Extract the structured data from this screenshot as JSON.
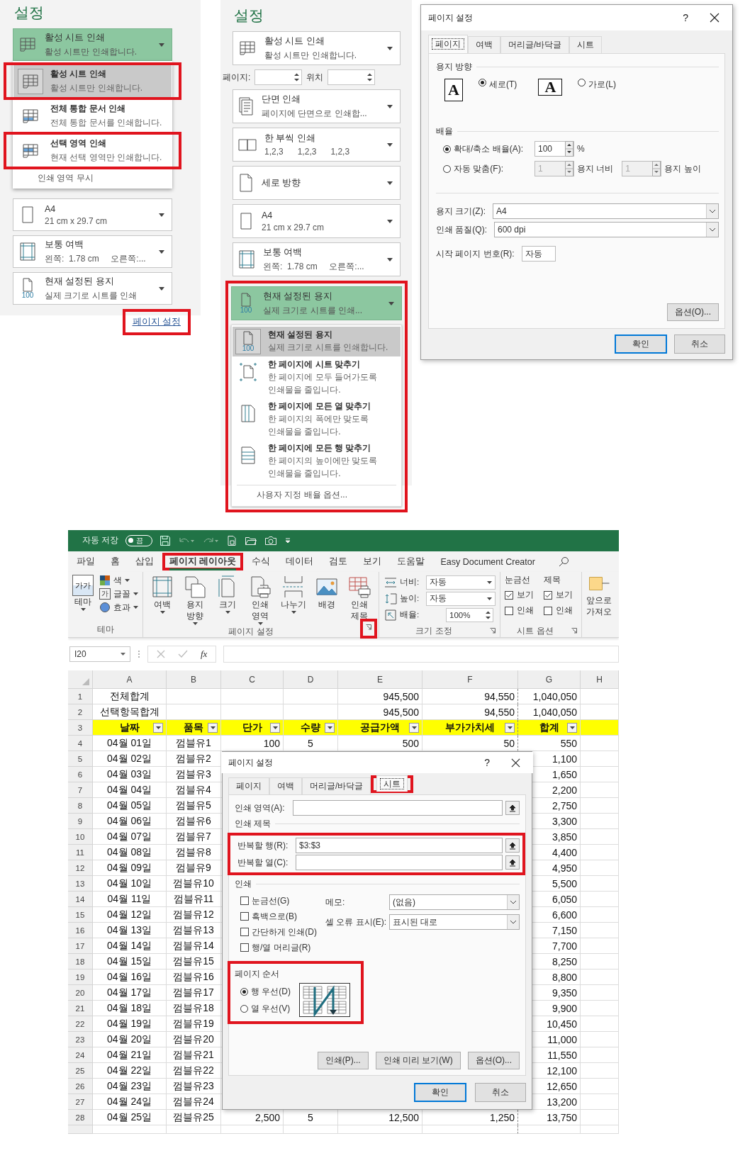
{
  "panel1": {
    "heading": "설정",
    "print_what": {
      "title": "활성 시트 인쇄",
      "subtitle": "활성 시트만 인쇄합니다.",
      "expanded": true
    },
    "menu": [
      {
        "title": "활성 시트 인쇄",
        "subtitle": "활성 시트만 인쇄합니다.",
        "selected": true,
        "highlighted": true
      },
      {
        "title": "전체 통합 문서 인쇄",
        "subtitle": "전체 통합 문서를 인쇄합니다.",
        "selected": false,
        "highlighted": false
      },
      {
        "title": "선택 영역 인쇄",
        "subtitle": "현재 선택 영역만 인쇄합니다.",
        "selected": false,
        "highlighted": true
      }
    ],
    "ignore_print_area": "인쇄 영역 무시",
    "settings": [
      {
        "title": "A4",
        "subtitle": "21 cm x 29.7 cm"
      },
      {
        "title": "보통 여백",
        "subtitle": "왼쪽:  1.78 cm     오른쪽:..."
      },
      {
        "badge": "100",
        "title": "현재 설정된 용지",
        "subtitle": "실제 크기로 시트를 인쇄"
      }
    ],
    "page_setup_link": {
      "label": "페이지 설정",
      "highlighted": true
    }
  },
  "panel2": {
    "heading": "설정",
    "settings": [
      {
        "kind": "dropdown",
        "title": "활성 시트 인쇄",
        "subtitle": "활성 시트만 인쇄합니다."
      },
      {
        "kind": "pages",
        "pages_label": "페이지:",
        "to_label": "위치"
      },
      {
        "kind": "dropdown",
        "title": "단면 인쇄",
        "subtitle": "페이지에 단면으로 인쇄합..."
      },
      {
        "kind": "dropdown",
        "title": "한 부씩 인쇄",
        "subtitle": "1,2,3      1,2,3      1,2,3"
      },
      {
        "kind": "dropdown",
        "title": "세로 방향"
      },
      {
        "kind": "dropdown",
        "title": "A4",
        "subtitle": "21 cm x 29.7 cm"
      },
      {
        "kind": "dropdown",
        "title": "보통 여백",
        "subtitle": "왼쪽:  1.78 cm     오른쪽:..."
      }
    ],
    "scaling": {
      "highlighted": true,
      "expanded": true,
      "badge": "100",
      "title": "현재 설정된 용지",
      "subtitle": "실제 크기로 시트를 인쇄...",
      "menu": [
        {
          "badge": "100",
          "title": "현재 설정된 용지",
          "lines": [
            "실제 크기로 시트를 인쇄합니다."
          ],
          "selected": true
        },
        {
          "title": "한 페이지에 시트 맞추기",
          "lines": [
            "한 페이지에 모두 들어가도록",
            "인쇄물을 줄입니다."
          ],
          "selected": false
        },
        {
          "title": "한 페이지에 모든 열 맞추기",
          "lines": [
            "한 페이지의 폭에만 맞도록",
            "인쇄물을 줄입니다."
          ],
          "selected": false
        },
        {
          "title": "한 페이지에 모든 행 맞추기",
          "lines": [
            "한 페이지의 높이에만 맞도록",
            "인쇄물을 줄입니다."
          ],
          "selected": false
        }
      ],
      "custom": "사용자 지정 배율 옵션..."
    }
  },
  "dialog1": {
    "title": "페이지 설정",
    "help": "?",
    "tabs": [
      {
        "label": "페이지",
        "selected": true
      },
      {
        "label": "여백",
        "selected": false
      },
      {
        "label": "머리글/바닥글",
        "selected": false
      },
      {
        "label": "시트",
        "selected": false
      }
    ],
    "orientation": {
      "heading": "용지 방향",
      "options": [
        {
          "letter": "A",
          "label": "세로(T)",
          "selected": true
        },
        {
          "letter": "A",
          "label": "가로(L)",
          "selected": false
        }
      ]
    },
    "scaling": {
      "heading": "배율",
      "options": [
        {
          "kind": "percent",
          "label": "확대/축소 배율(A):",
          "value": "100",
          "unit": "%",
          "selected": true
        },
        {
          "kind": "fit",
          "label": "자동 맞춤(F):",
          "wide": "1",
          "wide_label": "용지 너비",
          "tall": "1",
          "tall_label": "용지 높이",
          "selected": false
        }
      ]
    },
    "fields": [
      {
        "kind": "select",
        "label": "용지 크기(Z):",
        "value": "A4"
      },
      {
        "kind": "select",
        "label": "인쇄 품질(Q):",
        "value": "600 dpi"
      },
      {
        "kind": "text",
        "label": "시작 페이지 번호(R):",
        "value": "자동"
      }
    ],
    "options_button": "옵션(O)...",
    "footer": [
      {
        "label": "확인",
        "default": true
      },
      {
        "label": "취소",
        "default": false
      }
    ]
  },
  "excel": {
    "quick_access": {
      "autosave_label": "자동 저장",
      "autosave_state": "끔",
      "autosave_on": false
    },
    "tabs": [
      {
        "label": "파일",
        "selected": false,
        "highlighted": false
      },
      {
        "label": "홈",
        "selected": false,
        "highlighted": false
      },
      {
        "label": "삽입",
        "selected": false,
        "highlighted": false
      },
      {
        "label": "페이지 레이아웃",
        "selected": true,
        "highlighted": true
      },
      {
        "label": "수식",
        "selected": false,
        "highlighted": false
      },
      {
        "label": "데이터",
        "selected": false,
        "highlighted": false
      },
      {
        "label": "검토",
        "selected": false,
        "highlighted": false
      },
      {
        "label": "보기",
        "selected": false,
        "highlighted": false
      },
      {
        "label": "도움말",
        "selected": false,
        "highlighted": false
      },
      {
        "label": "Easy Document Creator",
        "selected": false,
        "highlighted": false
      }
    ],
    "theme_group": {
      "name": "테마",
      "big": {
        "label": "테마",
        "icon_text": "가가"
      },
      "small": [
        {
          "kind": "colors",
          "label": "색"
        },
        {
          "kind": "fonts",
          "label": "글꼴",
          "icon_text": "가"
        },
        {
          "kind": "effects",
          "label": "효과"
        }
      ]
    },
    "page_setup_group": {
      "name": "페이지 설정",
      "launcher_highlighted": true,
      "buttons": [
        {
          "lines": [
            "여백"
          ],
          "menu": true
        },
        {
          "lines": [
            "용지",
            "방향"
          ],
          "menu": true
        },
        {
          "lines": [
            "크기"
          ],
          "menu": true
        },
        {
          "lines": [
            "인쇄",
            "영역"
          ],
          "menu": true
        },
        {
          "lines": [
            "나누기"
          ],
          "menu": true
        },
        {
          "lines": [
            "배경"
          ],
          "menu": false
        },
        {
          "lines": [
            "인쇄",
            "제목"
          ],
          "menu": false
        }
      ]
    },
    "scale_group": {
      "name": "크기 조정",
      "rows": [
        {
          "kind": "dropdown",
          "label": "너비:",
          "value": "자동"
        },
        {
          "kind": "dropdown",
          "label": "높이:",
          "value": "자동"
        },
        {
          "kind": "spin",
          "label": "배율:",
          "value": "100%"
        }
      ]
    },
    "sheet_options_group": {
      "name": "시트 옵션",
      "columns": [
        {
          "title": "눈금선",
          "view": {
            "label": "보기",
            "checked": true
          },
          "print": {
            "label": "인쇄",
            "checked": false
          }
        },
        {
          "title": "제목",
          "view": {
            "label": "보기",
            "checked": true
          },
          "print": {
            "label": "인쇄",
            "checked": false
          }
        }
      ]
    },
    "arrange": {
      "lines": [
        "앞으로",
        "가져오"
      ]
    },
    "name_box": "I20",
    "function_label": "fx",
    "columns": [
      "A",
      "B",
      "C",
      "D",
      "E",
      "F",
      "G",
      "H"
    ],
    "rows": [
      {
        "kind": "total",
        "n": "1",
        "a": "전체합계",
        "e": "945,500",
        "f": "94,550",
        "g": "1,040,050"
      },
      {
        "kind": "total",
        "n": "2",
        "a": "선택항목합계",
        "e": "945,500",
        "f": "94,550",
        "g": "1,040,050"
      },
      {
        "kind": "header",
        "n": "3",
        "a": "날짜",
        "b": "품목",
        "c": "단가",
        "d": "수량",
        "e": "공급가액",
        "f": "부가가치세",
        "g": "합계"
      },
      {
        "kind": "data",
        "n": "4",
        "a": "04월 01일",
        "b": "껌블유1",
        "c": "100",
        "d": "5",
        "e": "500",
        "f": "50",
        "g": "550"
      },
      {
        "kind": "data",
        "n": "5",
        "a": "04월 02일",
        "b": "껌블유2",
        "g": "1,100"
      },
      {
        "kind": "data",
        "n": "6",
        "a": "04월 03일",
        "b": "껌블유3",
        "g": "1,650"
      },
      {
        "kind": "data",
        "n": "7",
        "a": "04월 04일",
        "b": "껌블유4",
        "g": "2,200"
      },
      {
        "kind": "data",
        "n": "8",
        "a": "04월 05일",
        "b": "껌블유5",
        "g": "2,750"
      },
      {
        "kind": "data",
        "n": "9",
        "a": "04월 06일",
        "b": "껌블유6",
        "g": "3,300"
      },
      {
        "kind": "data",
        "n": "10",
        "a": "04월 07일",
        "b": "껌블유7",
        "g": "3,850"
      },
      {
        "kind": "data",
        "n": "11",
        "a": "04월 08일",
        "b": "껌블유8",
        "g": "4,400"
      },
      {
        "kind": "data",
        "n": "12",
        "a": "04월 09일",
        "b": "껌블유9",
        "g": "4,950"
      },
      {
        "kind": "data",
        "n": "13",
        "a": "04월 10일",
        "b": "껌블유10",
        "g": "5,500"
      },
      {
        "kind": "data",
        "n": "14",
        "a": "04월 11일",
        "b": "껌블유11",
        "g": "6,050"
      },
      {
        "kind": "data",
        "n": "15",
        "a": "04월 12일",
        "b": "껌블유12",
        "g": "6,600"
      },
      {
        "kind": "data",
        "n": "16",
        "a": "04월 13일",
        "b": "껌블유13",
        "g": "7,150"
      },
      {
        "kind": "data",
        "n": "17",
        "a": "04월 14일",
        "b": "껌블유14",
        "g": "7,700"
      },
      {
        "kind": "data",
        "n": "18",
        "a": "04월 15일",
        "b": "껌블유15",
        "g": "8,250"
      },
      {
        "kind": "data",
        "n": "19",
        "a": "04월 16일",
        "b": "껌블유16",
        "g": "8,800"
      },
      {
        "kind": "data",
        "n": "20",
        "a": "04월 17일",
        "b": "껌블유17",
        "g": "9,350"
      },
      {
        "kind": "data",
        "n": "21",
        "a": "04월 18일",
        "b": "껌블유18",
        "g": "9,900"
      },
      {
        "kind": "data",
        "n": "22",
        "a": "04월 19일",
        "b": "껌블유19",
        "g": "10,450"
      },
      {
        "kind": "data",
        "n": "23",
        "a": "04월 20일",
        "b": "껌블유20",
        "g": "11,000"
      },
      {
        "kind": "data",
        "n": "24",
        "a": "04월 21일",
        "b": "껌블유21",
        "g": "11,550"
      },
      {
        "kind": "data",
        "n": "25",
        "a": "04월 22일",
        "b": "껌블유22",
        "g": "12,100"
      },
      {
        "kind": "data",
        "n": "26",
        "a": "04월 23일",
        "b": "껌블유23",
        "g": "12,650"
      },
      {
        "kind": "data",
        "n": "27",
        "a": "04월 24일",
        "b": "껌블유24",
        "g": "13,200"
      },
      {
        "kind": "data",
        "n": "28",
        "a": "04월 25일",
        "b": "껌블유25",
        "c": "2,500",
        "d": "5",
        "e": "12,500",
        "f": "1,250",
        "g": "13,750"
      }
    ],
    "dialog": {
      "title": "페이지 설정",
      "help": "?",
      "tabs": [
        {
          "label": "페이지",
          "selected": false,
          "highlighted": false
        },
        {
          "label": "여백",
          "selected": false,
          "highlighted": false
        },
        {
          "label": "머리글/바닥글",
          "selected": false,
          "highlighted": false
        },
        {
          "label": "시트",
          "selected": true,
          "highlighted": true
        }
      ],
      "print_area": {
        "label": "인쇄 영역(A):"
      },
      "print_titles": {
        "heading": "인쇄 제목",
        "highlighted": true,
        "rows": [
          {
            "label": "반복할 행(R):",
            "value": "$3:$3"
          },
          {
            "label": "반복할 열(C):"
          }
        ]
      },
      "print": {
        "heading": "인쇄",
        "checks": [
          {
            "label": "눈금선(G)",
            "checked": false
          },
          {
            "label": "흑백으로(B)",
            "checked": false
          },
          {
            "label": "간단하게 인쇄(D)",
            "checked": false
          },
          {
            "label": "행/열 머리글(R)",
            "checked": false
          }
        ],
        "selects": [
          {
            "label": "메모:",
            "value": "(없음)"
          },
          {
            "label": "셀 오류 표시(E):",
            "value": "표시된 대로"
          }
        ]
      },
      "page_order": {
        "heading": "페이지 순서",
        "highlighted": true,
        "options": [
          {
            "label": "행 우선(D)",
            "selected": true
          },
          {
            "label": "열 우선(V)",
            "selected": false
          }
        ]
      },
      "buttons": [
        "인쇄(P)...",
        "인쇄 미리 보기(W)",
        "옵션(O)..."
      ],
      "footer": [
        {
          "label": "확인",
          "default": true
        },
        {
          "label": "취소",
          "default": false
        }
      ]
    }
  }
}
